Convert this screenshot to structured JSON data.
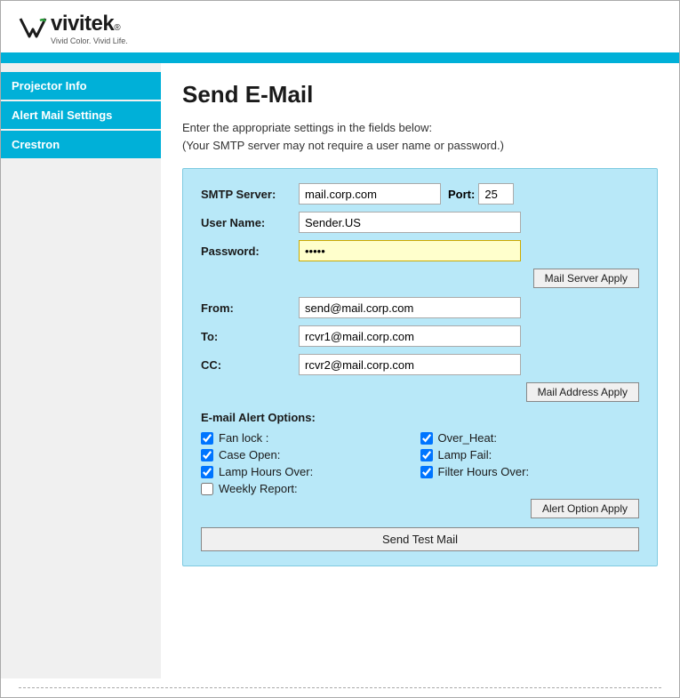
{
  "header": {
    "logo_brand": "vivitek",
    "logo_registered": "®",
    "logo_tagline": "Vivid Color. Vivid Life."
  },
  "sidebar": {
    "items": [
      {
        "id": "projector-info",
        "label": "Projector Info"
      },
      {
        "id": "alert-mail-settings",
        "label": "Alert Mail Settings"
      },
      {
        "id": "crestron",
        "label": "Crestron"
      }
    ]
  },
  "main": {
    "page_title": "Send E-Mail",
    "description_line1": "Enter the appropriate settings in the fields below:",
    "description_line2": "(Your SMTP server may not require a user name or password.)",
    "form": {
      "smtp_server_label": "SMTP Server:",
      "smtp_server_value": "mail.corp.com",
      "port_label": "Port:",
      "port_value": "25",
      "user_name_label": "User Name:",
      "user_name_value": "Sender.US",
      "password_label": "Password:",
      "password_value": "•••••",
      "mail_server_apply_btn": "Mail Server Apply",
      "from_label": "From:",
      "from_value": "send@mail.corp.com",
      "to_label": "To:",
      "to_value": "rcvr1@mail.corp.com",
      "cc_label": "CC:",
      "cc_value": "rcvr2@mail.corp.com",
      "mail_address_apply_btn": "Mail Address Apply",
      "alert_options_title": "E-mail Alert Options:",
      "checkboxes": [
        {
          "id": "fan-lock",
          "label": "Fan lock :",
          "checked": true,
          "col": 1
        },
        {
          "id": "over-heat",
          "label": "Over_Heat:",
          "checked": true,
          "col": 2
        },
        {
          "id": "case-open",
          "label": "Case Open:",
          "checked": true,
          "col": 1
        },
        {
          "id": "lamp-fail",
          "label": "Lamp Fail:",
          "checked": true,
          "col": 2
        },
        {
          "id": "lamp-hours-over",
          "label": "Lamp Hours Over:",
          "checked": true,
          "col": 1
        },
        {
          "id": "filter-hours-over",
          "label": "Filter Hours Over:",
          "checked": true,
          "col": 2
        },
        {
          "id": "weekly-report",
          "label": "Weekly Report:",
          "checked": false,
          "col": 1
        }
      ],
      "alert_option_apply_btn": "Alert Option Apply",
      "send_test_mail_btn": "Send Test Mail"
    }
  }
}
